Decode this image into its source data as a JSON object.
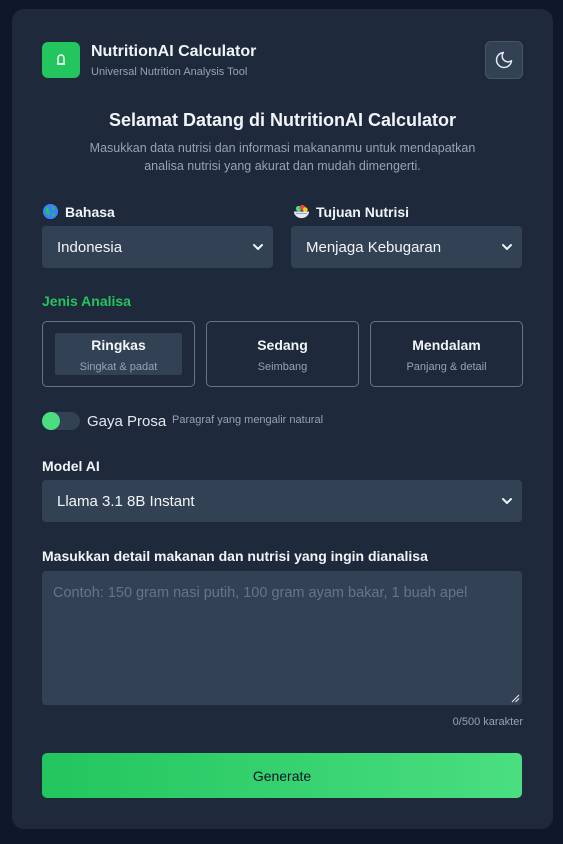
{
  "header": {
    "title": "NutritionAI Calculator",
    "subtitle": "Universal Nutrition Analysis Tool",
    "theme_toggle_icon": "moon-icon"
  },
  "welcome": {
    "title": "Selamat Datang di NutritionAI Calculator",
    "text": "Masukkan data nutrisi dan informasi makananmu untuk mendapatkan analisa nutrisi yang akurat dan mudah dimengerti."
  },
  "language": {
    "icon": "globe-icon",
    "label": "Bahasa",
    "selected": "Indonesia"
  },
  "goal": {
    "icon": "salad-bowl-icon",
    "label": "Tujuan Nutrisi",
    "selected": "Menjaga Kebugaran"
  },
  "analysis": {
    "label": "Jenis Analisa",
    "options": [
      {
        "title": "Ringkas",
        "subtitle": "Singkat & padat",
        "active": true
      },
      {
        "title": "Sedang",
        "subtitle": "Seimbang",
        "active": false
      },
      {
        "title": "Mendalam",
        "subtitle": "Panjang & detail",
        "active": false
      }
    ]
  },
  "prose": {
    "label": "Gaya Prosa",
    "description": "Paragraf yang mengalir natural",
    "enabled": false
  },
  "model": {
    "label": "Model AI",
    "selected": "Llama 3.1 8B Instant"
  },
  "input": {
    "label": "Masukkan detail makanan dan nutrisi yang ingin dianalisa",
    "value": "",
    "placeholder": "Contoh: 150 gram nasi putih, 100 gram ayam bakar, 1 buah apel",
    "char_count": "0/500 karakter"
  },
  "generate_label": "Generate",
  "colors": {
    "accent": "#22c55e",
    "background": "#0f172a",
    "card": "#1e293b",
    "input": "#334155"
  }
}
